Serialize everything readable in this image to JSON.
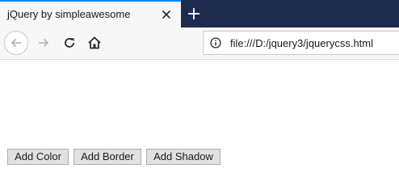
{
  "browser": {
    "tab": {
      "title": "jQuery by simpleawesome"
    },
    "address_bar": {
      "url": "file:///D:/jquery3/jquerycss.html"
    },
    "icons": {
      "close": "close-icon",
      "new_tab": "plus-icon",
      "back": "back-arrow-icon",
      "forward": "forward-arrow-icon",
      "reload": "reload-icon",
      "home": "home-icon",
      "info": "info-icon"
    },
    "colors": {
      "tab_accent": "#0a84ff",
      "tabstrip": "#1f2b4d"
    }
  },
  "page": {
    "buttons": [
      {
        "label": "Add Color"
      },
      {
        "label": "Add Border"
      },
      {
        "label": "Add Shadow"
      }
    ]
  }
}
